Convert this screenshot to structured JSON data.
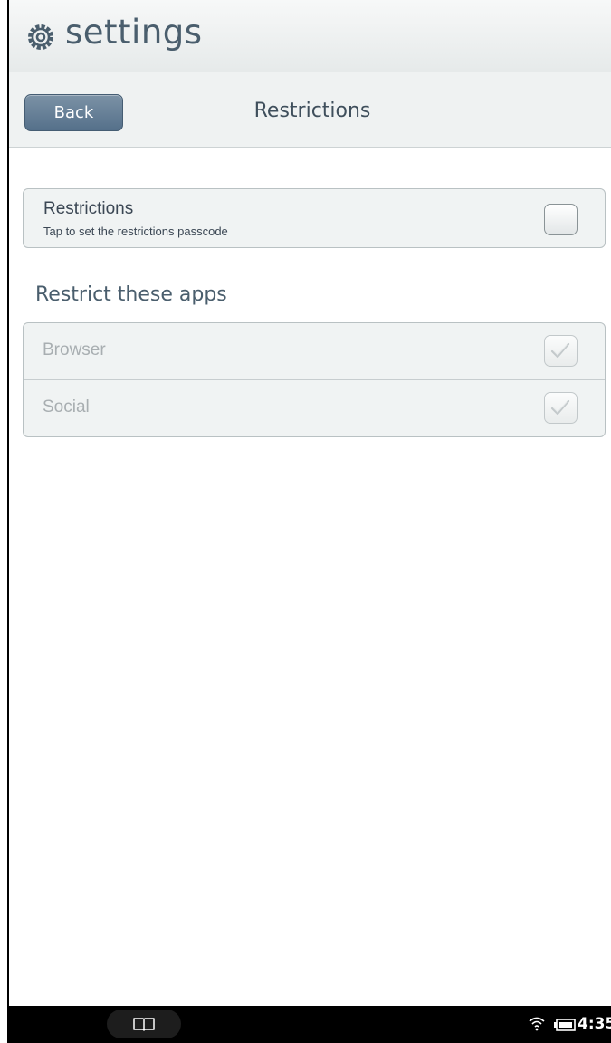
{
  "app": {
    "title": "settings",
    "icon": "gear-icon"
  },
  "nav": {
    "back_label": "Back",
    "page_title": "Restrictions"
  },
  "restrictions": {
    "label": "Restrictions",
    "sublabel": "Tap to set the restrictions passcode",
    "enabled": false
  },
  "apps_section": {
    "header": "Restrict these apps",
    "items": [
      {
        "label": "Browser",
        "checked": true,
        "disabled": true
      },
      {
        "label": "Social",
        "checked": true,
        "disabled": true
      }
    ]
  },
  "system_bar": {
    "home_icon": "book-icon",
    "wifi_icon": "wifi-icon",
    "battery_icon": "battery-icon",
    "time": "4:35"
  },
  "colors": {
    "header_text": "#4a5e6d",
    "back_button": "#5f7891",
    "disabled_text": "#a8aeb1",
    "system_bar": "#000000"
  }
}
